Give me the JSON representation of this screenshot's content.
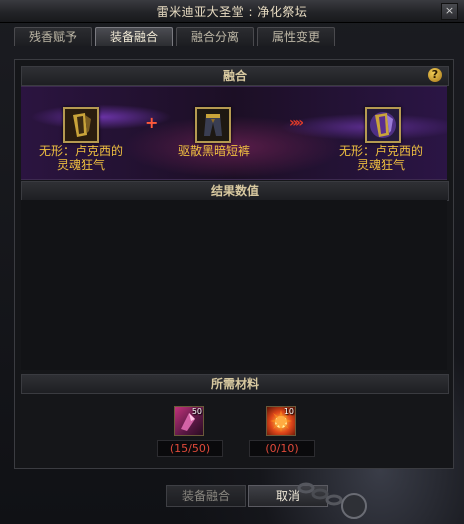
{
  "window": {
    "title": "雷米迪亚大圣堂 : 净化祭坛",
    "close_label": "×"
  },
  "tabs": [
    {
      "label": "残香赋予",
      "active": false
    },
    {
      "label": "装备融合",
      "active": true
    },
    {
      "label": "融合分离",
      "active": false
    },
    {
      "label": "属性变更",
      "active": false
    }
  ],
  "fusion": {
    "header": "融合",
    "help_label": "?",
    "item_left": {
      "name": "无形：卢克西的灵魂狂气",
      "icon": "gauntlet-icon"
    },
    "plus_label": "+",
    "item_middle": {
      "name": "驱散黑暗短裤",
      "icon": "pants-icon"
    },
    "arrow_label": "»»",
    "item_result": {
      "name": "无形：卢克西的灵魂狂气",
      "icon": "gauntlet-glow-icon"
    }
  },
  "results": {
    "header": "结果数值"
  },
  "materials": {
    "header": "所需材料",
    "items": [
      {
        "icon": "crystal-shard-icon",
        "badge": "50",
        "count": "(15/50)"
      },
      {
        "icon": "fire-orb-icon",
        "badge": "10",
        "count": "(0/10)"
      }
    ]
  },
  "buttons": {
    "fuse": "装备融合",
    "cancel": "取消"
  },
  "colors": {
    "item_name": "#f0c040",
    "count_insufficient": "#e04a3a",
    "header_text": "#d8c9a0"
  }
}
